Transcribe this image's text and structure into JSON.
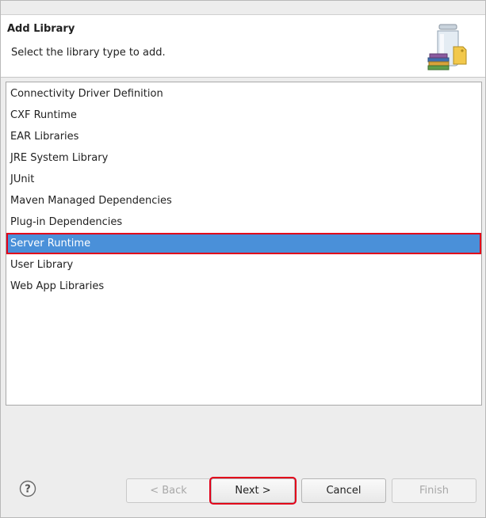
{
  "dialog": {
    "title": "Add Library",
    "description": "Select the library type to add."
  },
  "library_list": {
    "items": [
      {
        "label": "Connectivity Driver Definition",
        "selected": false
      },
      {
        "label": "CXF Runtime",
        "selected": false
      },
      {
        "label": "EAR Libraries",
        "selected": false
      },
      {
        "label": "JRE System Library",
        "selected": false
      },
      {
        "label": "JUnit",
        "selected": false
      },
      {
        "label": "Maven Managed Dependencies",
        "selected": false
      },
      {
        "label": "Plug-in Dependencies",
        "selected": false
      },
      {
        "label": "Server Runtime",
        "selected": true
      },
      {
        "label": "User Library",
        "selected": false
      },
      {
        "label": "Web App Libraries",
        "selected": false
      }
    ]
  },
  "buttons": {
    "back": {
      "label": "< Back",
      "enabled": false
    },
    "next": {
      "label": "Next >",
      "enabled": true
    },
    "cancel": {
      "label": "Cancel",
      "enabled": true
    },
    "finish": {
      "label": "Finish",
      "enabled": false
    }
  },
  "icons": {
    "help": "help-icon",
    "banner": "library-jar-icon"
  },
  "colors": {
    "selection": "#4a90d9",
    "highlight_outline": "#e2001a"
  }
}
